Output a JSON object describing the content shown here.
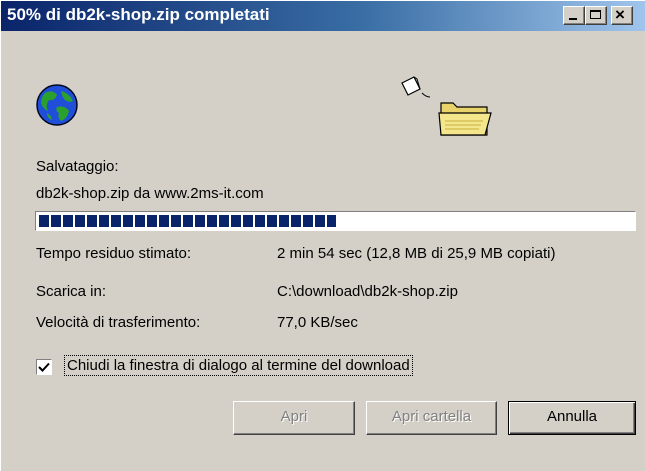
{
  "window": {
    "title": "50% di db2k-shop.zip completati",
    "controls": {
      "minimize": "minimize-icon",
      "maximize": "maximize-icon",
      "close": "close-icon"
    }
  },
  "icons": {
    "globe": "globe-icon",
    "document": "document-icon",
    "folder": "folder-icon"
  },
  "status": {
    "label": "Salvataggio:",
    "source": "db2k-shop.zip da www.2ms-it.com"
  },
  "progress": {
    "percent": 50
  },
  "details": [
    {
      "label": "Tempo residuo stimato:",
      "value": "2 min 54 sec (12,8 MB di 25,9 MB copiati)"
    },
    {
      "label": "Scarica in:",
      "value": "C:\\download\\db2k-shop.zip"
    },
    {
      "label": "Velocità di trasferimento:",
      "value": "77,0 KB/sec"
    }
  ],
  "close_on_complete": {
    "label": "Chiudi la finestra di dialogo al termine del download",
    "checked": true
  },
  "buttons": {
    "open": "Apri",
    "open_folder": "Apri cartella",
    "cancel": "Annulla"
  },
  "colors": {
    "face": "#d4d0c8",
    "title_start": "#0a246a",
    "title_end": "#a6caf0",
    "progress": "#0a246a"
  }
}
